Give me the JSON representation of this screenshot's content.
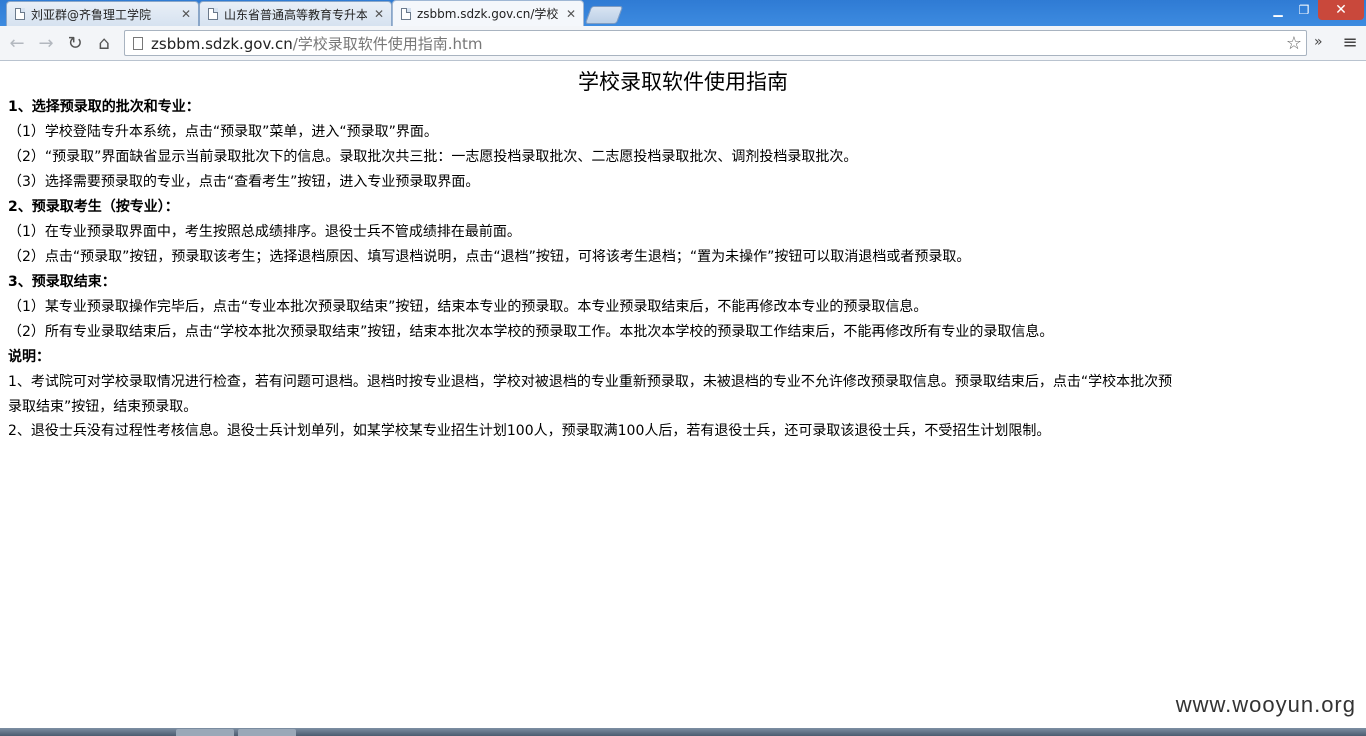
{
  "browser": {
    "tabs": [
      {
        "label": "刘亚群@齐鲁理工学院",
        "active": false
      },
      {
        "label": "山东省普通高等教育专升本",
        "active": false
      },
      {
        "label": "zsbbm.sdzk.gov.cn/学校",
        "active": true
      }
    ],
    "window_controls": {
      "minimize": "▁",
      "maximize": "❐",
      "close": "✕"
    },
    "address": {
      "host": "zsbbm.sdzk.gov.cn",
      "path": "/学校录取软件使用指南.htm"
    },
    "icons": {
      "back": "←",
      "forward": "→",
      "reload": "↻",
      "home": "⌂",
      "star": "☆",
      "extensions": "»",
      "menu": "≡",
      "tab_close": "✕"
    }
  },
  "page": {
    "title": "学校录取软件使用指南",
    "lines": [
      {
        "text": "1、选择预录取的批次和专业：",
        "bold": true
      },
      {
        "text": "（1）学校登陆专升本系统，点击“预录取”菜单，进入“预录取”界面。",
        "bold": false
      },
      {
        "text": "（2）“预录取”界面缺省显示当前录取批次下的信息。录取批次共三批：一志愿投档录取批次、二志愿投档录取批次、调剂投档录取批次。",
        "bold": false
      },
      {
        "text": "（3）选择需要预录取的专业，点击“查看考生”按钮，进入专业预录取界面。",
        "bold": false
      },
      {
        "text": "2、预录取考生（按专业）：",
        "bold": true
      },
      {
        "text": "（1）在专业预录取界面中，考生按照总成绩排序。退役士兵不管成绩排在最前面。",
        "bold": false
      },
      {
        "text": "（2）点击“预录取”按钮，预录取该考生；选择退档原因、填写退档说明，点击“退档”按钮，可将该考生退档；“置为未操作”按钮可以取消退档或者预录取。",
        "bold": false
      },
      {
        "text": "3、预录取结束：",
        "bold": true
      },
      {
        "text": "（1）某专业预录取操作完毕后，点击“专业本批次预录取结束”按钮，结束本专业的预录取。本专业预录取结束后，不能再修改本专业的预录取信息。",
        "bold": false
      },
      {
        "text": "（2）所有专业录取结束后，点击“学校本批次预录取结束”按钮，结束本批次本学校的预录取工作。本批次本学校的预录取工作结束后，不能再修改所有专业的录取信息。",
        "bold": false
      },
      {
        "text": "说明：",
        "bold": true
      },
      {
        "text": "1、考试院可对学校录取情况进行检查，若有问题可退档。退档时按专业退档，学校对被退档的专业重新预录取，未被退档的专业不允许修改预录取信息。预录取结束后，点击“学校本批次预",
        "bold": false
      },
      {
        "text": "录取结束”按钮，结束预录取。",
        "bold": false
      },
      {
        "text": "2、退役士兵没有过程性考核信息。退役士兵计划单列，如某学校某专业招生计划100人，预录取满100人后，若有退役士兵，还可录取该退役士兵，不受招生计划限制。",
        "bold": false
      }
    ],
    "watermark": "www.wooyun.org"
  }
}
